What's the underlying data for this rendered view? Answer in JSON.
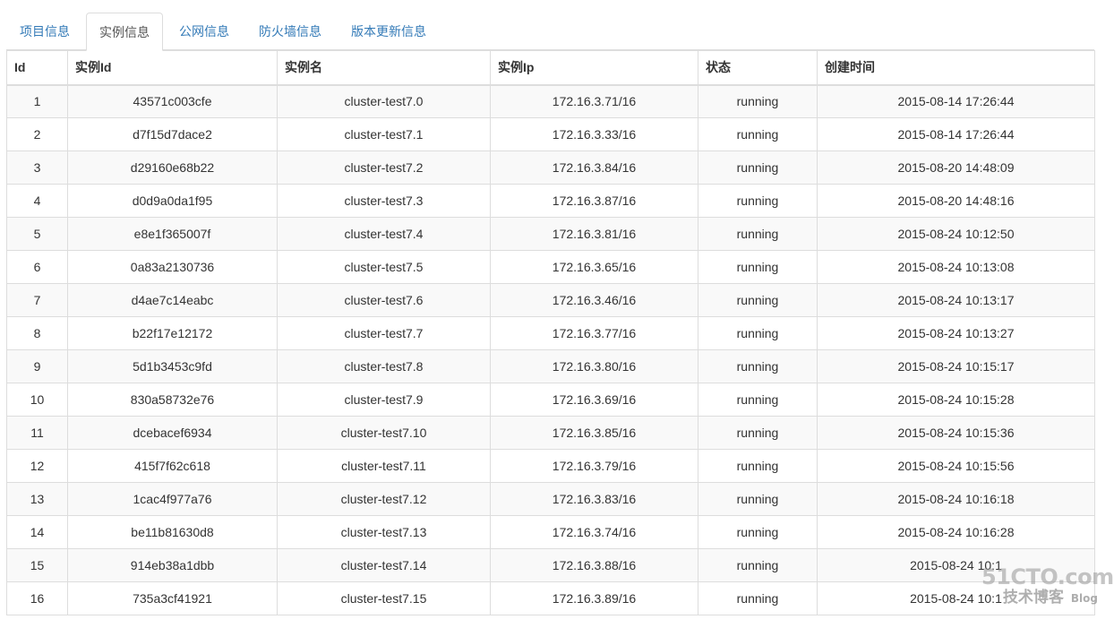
{
  "tabs": [
    {
      "label": "项目信息",
      "active": false
    },
    {
      "label": "实例信息",
      "active": true
    },
    {
      "label": "公网信息",
      "active": false
    },
    {
      "label": "防火墙信息",
      "active": false
    },
    {
      "label": "版本更新信息",
      "active": false
    }
  ],
  "table": {
    "headers": [
      "Id",
      "实例Id",
      "实例名",
      "实例Ip",
      "状态",
      "创建时间"
    ],
    "rows": [
      [
        "1",
        "43571c003cfe",
        "cluster-test7.0",
        "172.16.3.71/16",
        "running",
        "2015-08-14 17:26:44"
      ],
      [
        "2",
        "d7f15d7dace2",
        "cluster-test7.1",
        "172.16.3.33/16",
        "running",
        "2015-08-14 17:26:44"
      ],
      [
        "3",
        "d29160e68b22",
        "cluster-test7.2",
        "172.16.3.84/16",
        "running",
        "2015-08-20 14:48:09"
      ],
      [
        "4",
        "d0d9a0da1f95",
        "cluster-test7.3",
        "172.16.3.87/16",
        "running",
        "2015-08-20 14:48:16"
      ],
      [
        "5",
        "e8e1f365007f",
        "cluster-test7.4",
        "172.16.3.81/16",
        "running",
        "2015-08-24 10:12:50"
      ],
      [
        "6",
        "0a83a2130736",
        "cluster-test7.5",
        "172.16.3.65/16",
        "running",
        "2015-08-24 10:13:08"
      ],
      [
        "7",
        "d4ae7c14eabc",
        "cluster-test7.6",
        "172.16.3.46/16",
        "running",
        "2015-08-24 10:13:17"
      ],
      [
        "8",
        "b22f17e12172",
        "cluster-test7.7",
        "172.16.3.77/16",
        "running",
        "2015-08-24 10:13:27"
      ],
      [
        "9",
        "5d1b3453c9fd",
        "cluster-test7.8",
        "172.16.3.80/16",
        "running",
        "2015-08-24 10:15:17"
      ],
      [
        "10",
        "830a58732e76",
        "cluster-test7.9",
        "172.16.3.69/16",
        "running",
        "2015-08-24 10:15:28"
      ],
      [
        "11",
        "dcebacef6934",
        "cluster-test7.10",
        "172.16.3.85/16",
        "running",
        "2015-08-24 10:15:36"
      ],
      [
        "12",
        "415f7f62c618",
        "cluster-test7.11",
        "172.16.3.79/16",
        "running",
        "2015-08-24 10:15:56"
      ],
      [
        "13",
        "1cac4f977a76",
        "cluster-test7.12",
        "172.16.3.83/16",
        "running",
        "2015-08-24 10:16:18"
      ],
      [
        "14",
        "be11b81630d8",
        "cluster-test7.13",
        "172.16.3.74/16",
        "running",
        "2015-08-24 10:16:28"
      ],
      [
        "15",
        "914eb38a1dbb",
        "cluster-test7.14",
        "172.16.3.88/16",
        "running",
        "2015-08-24 10:1"
      ],
      [
        "16",
        "735a3cf41921",
        "cluster-test7.15",
        "172.16.3.89/16",
        "running",
        "2015-08-24 10:1"
      ]
    ]
  },
  "watermark": {
    "site": "51CTO.com",
    "cn": "技术博客",
    "blog": "Blog"
  },
  "colors": {
    "link": "#337ab7",
    "active_tab_text": "#555555",
    "border": "#dddddd",
    "stripe": "#f9f9f9"
  }
}
